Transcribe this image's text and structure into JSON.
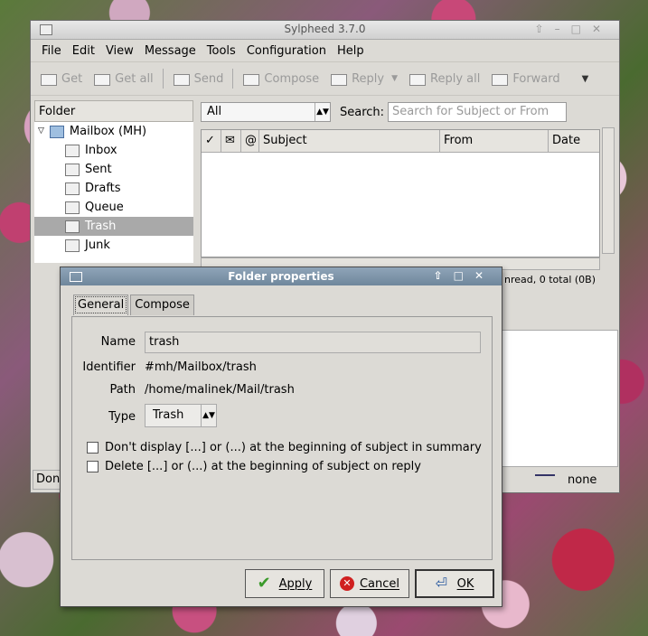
{
  "main_window": {
    "title": "Sylpheed 3.7.0",
    "menu": [
      "File",
      "Edit",
      "View",
      "Message",
      "Tools",
      "Configuration",
      "Help"
    ],
    "toolbar": [
      "Get",
      "Get all",
      "Send",
      "Compose",
      "Reply",
      "Reply all",
      "Forward"
    ],
    "folder_header": "Folder",
    "mailbox": "Mailbox (MH)",
    "folders": [
      "Inbox",
      "Sent",
      "Drafts",
      "Queue",
      "Trash",
      "Junk"
    ],
    "selected_folder": "Trash",
    "filter": "All",
    "search_label": "Search:",
    "search_placeholder": "Search for Subject or From",
    "columns": [
      "Subject",
      "From",
      "Date"
    ],
    "status_summary": "nread, 0 total (0B)",
    "status_done": "Don",
    "status_none": "none"
  },
  "dialog": {
    "title": "Folder properties",
    "tabs": [
      "General",
      "Compose"
    ],
    "name_label": "Name",
    "name_value": "trash",
    "identifier_label": "Identifier",
    "identifier_value": "#mh/Mailbox/trash",
    "path_label": "Path",
    "path_value": "/home/malinek/Mail/trash",
    "type_label": "Type",
    "type_value": "Trash",
    "checkbox1": "Don't display [...] or (...) at the beginning of subject in summary",
    "checkbox2": "Delete [...] or (...) at the beginning of subject on reply",
    "apply": "Apply",
    "cancel": "Cancel",
    "ok": "OK"
  }
}
